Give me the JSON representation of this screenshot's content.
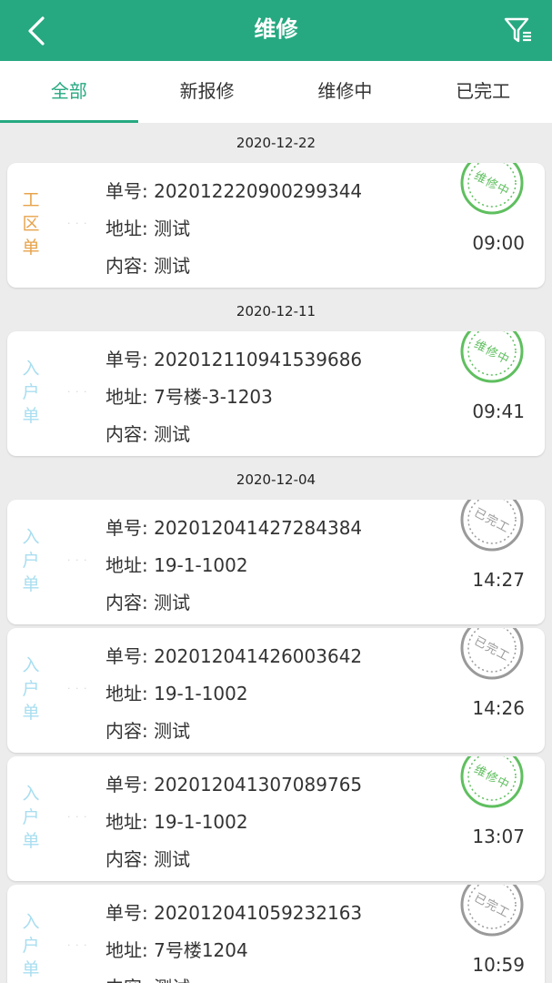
{
  "header": {
    "title": "维修",
    "back_icon": "chevron-left-icon",
    "filter_icon": "filter-icon"
  },
  "tabs": [
    {
      "label": "全部",
      "active": true
    },
    {
      "label": "新报修",
      "active": false
    },
    {
      "label": "维修中",
      "active": false
    },
    {
      "label": "已完工",
      "active": false
    }
  ],
  "groups": [
    {
      "date": "2020-12-22",
      "orders": [
        {
          "type": "工区单",
          "kind": "work",
          "number": "单号: 202012220900299344",
          "address": "地址: 测试",
          "content": "内容: 测试",
          "time": "09:00",
          "status": "维修中"
        }
      ]
    },
    {
      "date": "2020-12-11",
      "orders": [
        {
          "type": "入户单",
          "kind": "home",
          "number": "单号: 202012110941539686",
          "address": "地址: 7号楼-3-1203",
          "content": "内容: 测试",
          "time": "09:41",
          "status": "维修中"
        }
      ]
    },
    {
      "date": "2020-12-04",
      "orders": [
        {
          "type": "入户单",
          "kind": "home",
          "number": "单号: 202012041427284384",
          "address": "地址: 19-1-1002",
          "content": "内容: 测试",
          "time": "14:27",
          "status": "已完工"
        },
        {
          "type": "入户单",
          "kind": "home",
          "number": "单号: 202012041426003642",
          "address": "地址: 19-1-1002",
          "content": "内容: 测试",
          "time": "14:26",
          "status": "已完工"
        },
        {
          "type": "入户单",
          "kind": "home",
          "number": "单号: 202012041307089765",
          "address": "地址: 19-1-1002",
          "content": "内容: 测试",
          "time": "13:07",
          "status": "维修中"
        },
        {
          "type": "入户单",
          "kind": "home",
          "number": "单号: 202012041059232163",
          "address": "地址: 7号楼1204",
          "content": "内容: 测试",
          "time": "10:59",
          "status": "已完工"
        }
      ]
    }
  ],
  "colors": {
    "primary": "#26a981",
    "stamp_active": "#5fbf5f",
    "stamp_done": "#9a9a9a",
    "work_type": "#e7a34b",
    "home_type": "#a9def0"
  }
}
